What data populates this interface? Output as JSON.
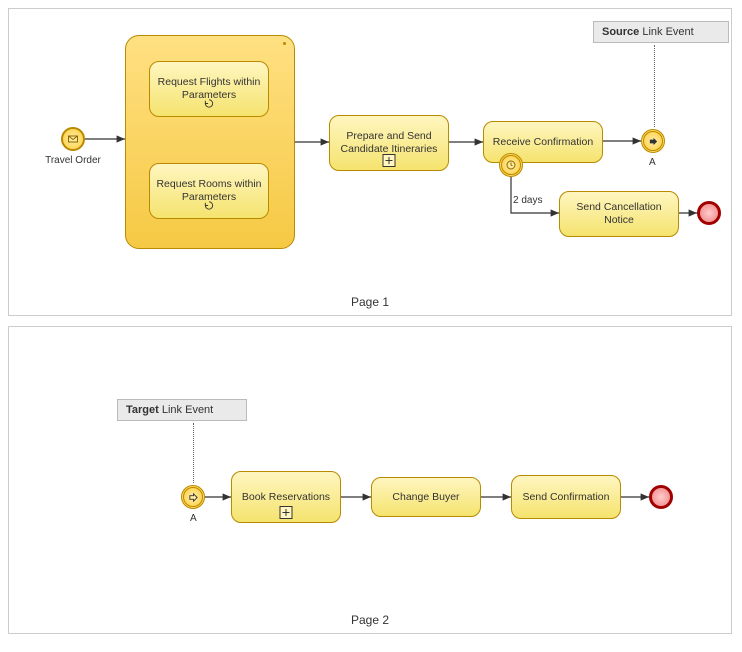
{
  "page1": {
    "label": "Page 1",
    "annotation": {
      "bold": "Source",
      "rest": " Link Event"
    },
    "startEvent": {
      "label": "Travel Order"
    },
    "linkEvent": {
      "label": "A"
    },
    "subprocess": {
      "task1": "Request Flights within Parameters",
      "task2": "Request Rooms within Parameters"
    },
    "tasks": {
      "prepare": "Prepare and Send Candidate Itineraries",
      "receive": "Receive Confirmation",
      "cancel": "Send Cancellation Notice"
    },
    "timer": {
      "label": "2 days"
    }
  },
  "page2": {
    "label": "Page 2",
    "annotation": {
      "bold": "Target",
      "rest": " Link Event"
    },
    "linkEvent": {
      "label": "A"
    },
    "tasks": {
      "book": "Book Reservations",
      "change": "Change Buyer",
      "send": "Send Confirmation"
    }
  }
}
